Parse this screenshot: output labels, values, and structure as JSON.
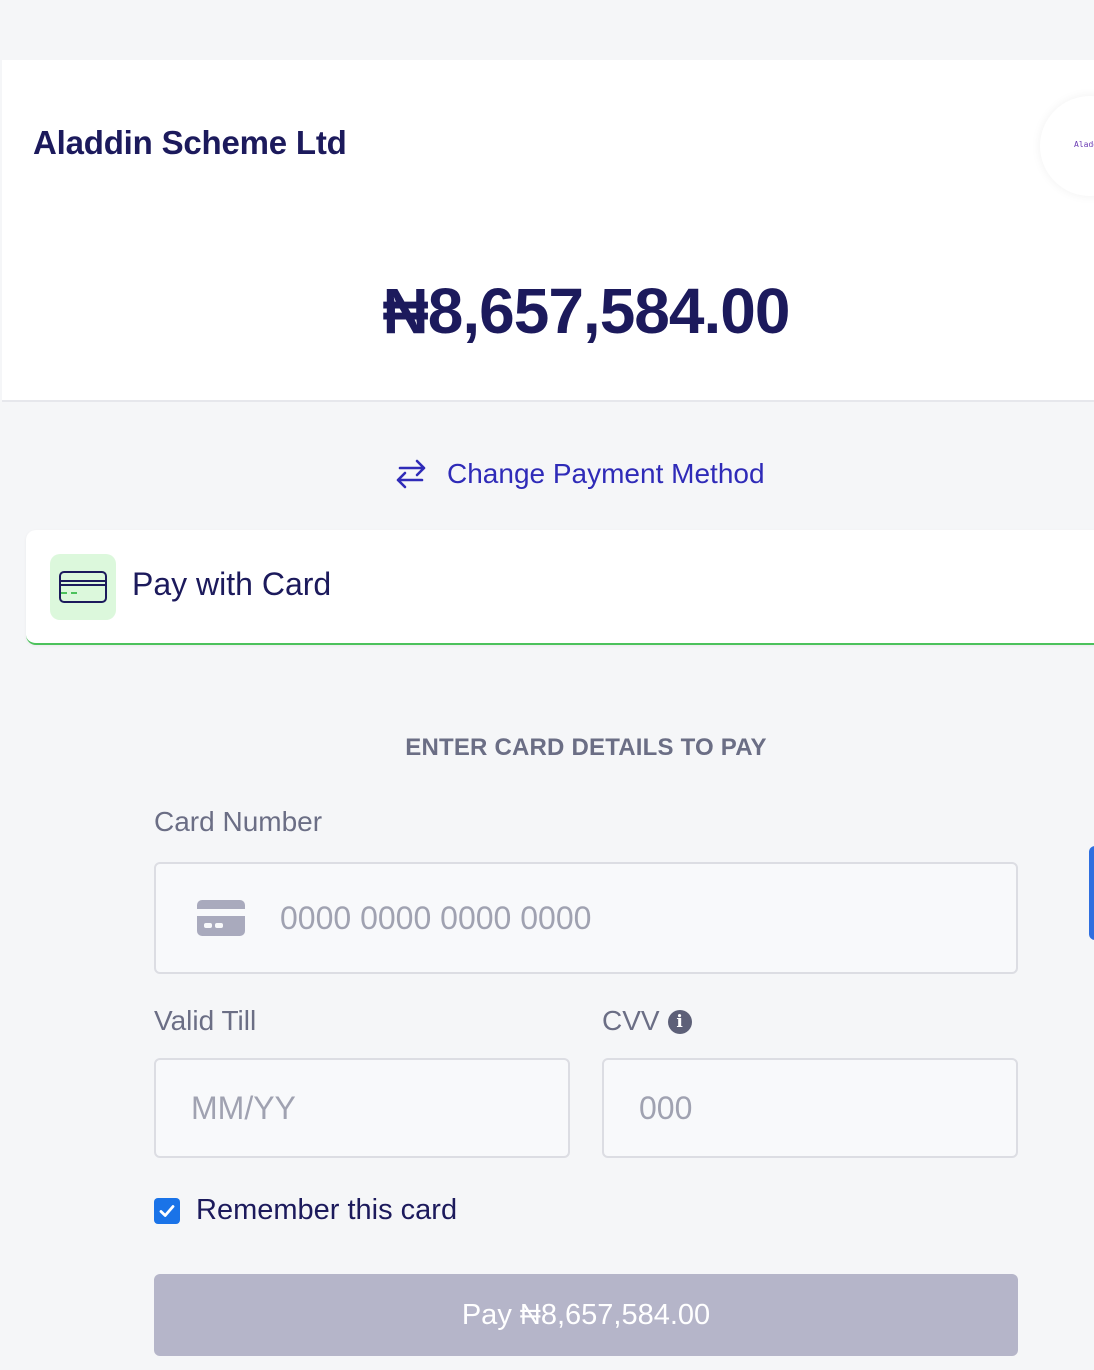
{
  "merchant": {
    "name": "Aladdin Scheme Ltd",
    "logo_text": "Aladd"
  },
  "amount": "₦8,657,584.00",
  "change_method": {
    "label": "Change Payment Method",
    "icon": "swap-arrows-icon"
  },
  "payment_method": {
    "label": "Pay with Card",
    "icon": "credit-card-icon"
  },
  "form": {
    "title": "ENTER CARD DETAILS TO PAY",
    "card_number": {
      "label": "Card Number",
      "placeholder": "0000 0000 0000 0000",
      "value": ""
    },
    "valid_till": {
      "label": "Valid Till",
      "placeholder": "MM/YY",
      "value": ""
    },
    "cvv": {
      "label": "CVV",
      "placeholder": "000",
      "value": ""
    },
    "remember_card": {
      "label": "Remember this card",
      "checked": true
    },
    "pay_button": {
      "label": "Pay ₦8,657,584.00",
      "enabled": false
    }
  },
  "colors": {
    "brand_navy": "#1c1a5c",
    "link_blue": "#2f2bb8",
    "accent_green": "#4cc25c",
    "checkbox_blue": "#1a73e8",
    "button_disabled": "#b5b5c9"
  }
}
